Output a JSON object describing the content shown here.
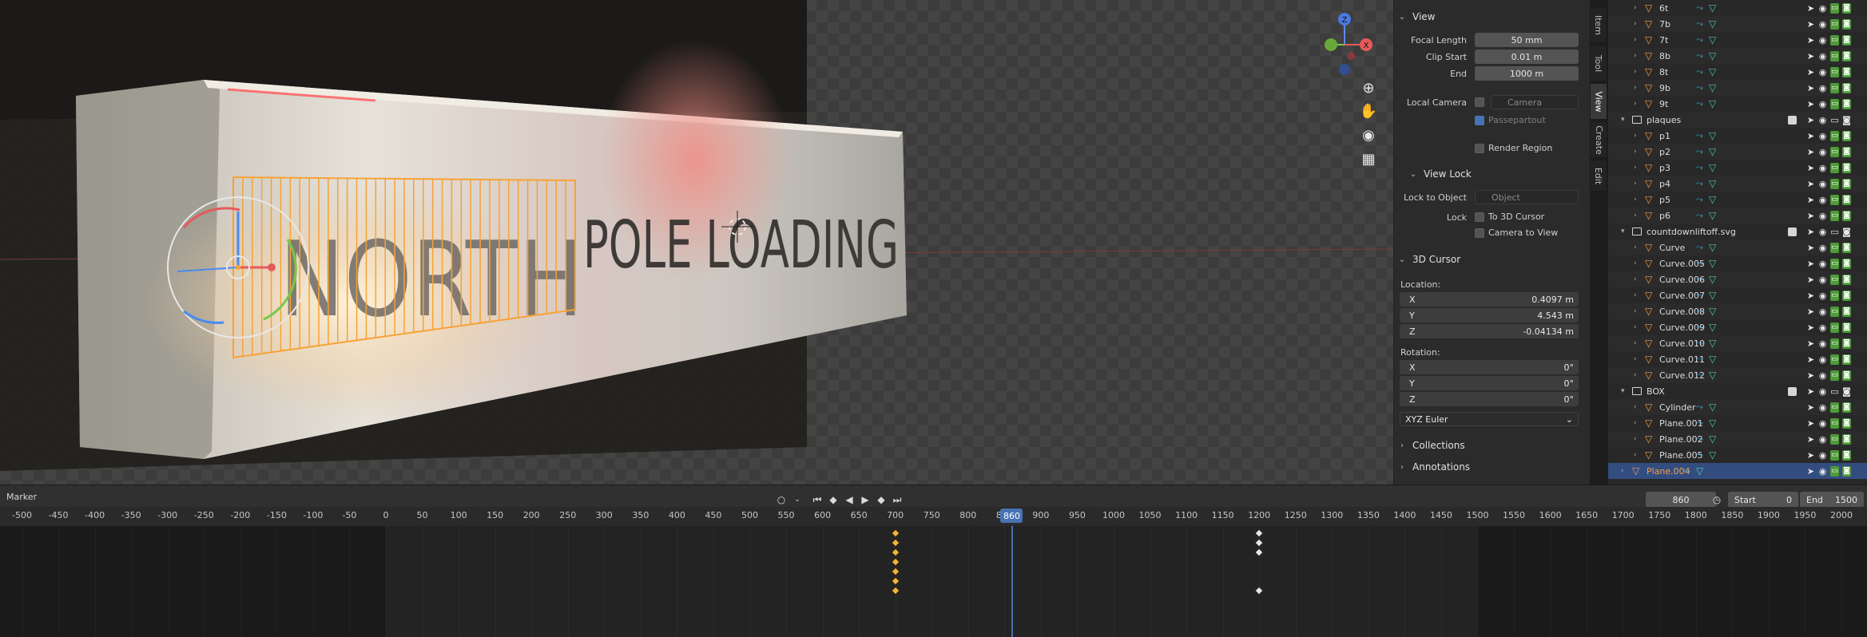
{
  "viewport": {
    "sign_text": "NORTH POLE LOADING",
    "gizmo_axes": {
      "z": "Z",
      "x": "X",
      "y": "Y"
    },
    "tools": [
      "zoom-icon",
      "hand-icon",
      "camera-icon",
      "grid-icon"
    ]
  },
  "tabs": [
    "Item",
    "Tool",
    "View",
    "Create",
    "Edit"
  ],
  "view_panel": {
    "title": "View",
    "focal_length_label": "Focal Length",
    "focal_length": "50 mm",
    "clip_start_label": "Clip Start",
    "clip_start": "0.01 m",
    "end_label": "End",
    "end": "1000 m",
    "local_camera_label": "Local Camera",
    "camera_placeholder": "Camera",
    "passepartout_label": "Passepartout",
    "render_region_label": "Render Region"
  },
  "view_lock": {
    "title": "View Lock",
    "lock_to_object_label": "Lock to Object",
    "object_placeholder": "Object",
    "lock_label": "Lock",
    "to_3d_cursor_label": "To 3D Cursor",
    "camera_to_view_label": "Camera to View"
  },
  "cursor_panel": {
    "title": "3D Cursor",
    "location_label": "Location:",
    "loc": [
      {
        "axis": "X",
        "value": "0.4097 m"
      },
      {
        "axis": "Y",
        "value": "4.543 m"
      },
      {
        "axis": "Z",
        "value": "-0.04134 m"
      }
    ],
    "rotation_label": "Rotation:",
    "rot": [
      {
        "axis": "X",
        "value": "0°"
      },
      {
        "axis": "Y",
        "value": "0°"
      },
      {
        "axis": "Z",
        "value": "0°"
      }
    ],
    "rotation_mode": "XYZ Euler"
  },
  "collections_label": "Collections",
  "annotations_label": "Annotations",
  "outliner": {
    "rows": [
      {
        "name": "6t",
        "depth": 2,
        "kind": "mesh"
      },
      {
        "name": "7b",
        "depth": 2,
        "kind": "mesh"
      },
      {
        "name": "7t",
        "depth": 2,
        "kind": "mesh"
      },
      {
        "name": "8b",
        "depth": 2,
        "kind": "mesh"
      },
      {
        "name": "8t",
        "depth": 2,
        "kind": "mesh"
      },
      {
        "name": "9b",
        "depth": 2,
        "kind": "mesh"
      },
      {
        "name": "9t",
        "depth": 2,
        "kind": "mesh"
      },
      {
        "name": "plaques",
        "depth": 1,
        "kind": "collection"
      },
      {
        "name": "p1",
        "depth": 2,
        "kind": "mesh"
      },
      {
        "name": "p2",
        "depth": 2,
        "kind": "mesh"
      },
      {
        "name": "p3",
        "depth": 2,
        "kind": "mesh"
      },
      {
        "name": "p4",
        "depth": 2,
        "kind": "mesh"
      },
      {
        "name": "p5",
        "depth": 2,
        "kind": "mesh"
      },
      {
        "name": "p6",
        "depth": 2,
        "kind": "mesh"
      },
      {
        "name": "countdownliftoff.svg",
        "depth": 1,
        "kind": "collection"
      },
      {
        "name": "Curve",
        "depth": 2,
        "kind": "mesh"
      },
      {
        "name": "Curve.005",
        "depth": 2,
        "kind": "mesh"
      },
      {
        "name": "Curve.006",
        "depth": 2,
        "kind": "mesh"
      },
      {
        "name": "Curve.007",
        "depth": 2,
        "kind": "mesh"
      },
      {
        "name": "Curve.008",
        "depth": 2,
        "kind": "mesh"
      },
      {
        "name": "Curve.009",
        "depth": 2,
        "kind": "mesh"
      },
      {
        "name": "Curve.010",
        "depth": 2,
        "kind": "mesh"
      },
      {
        "name": "Curve.011",
        "depth": 2,
        "kind": "mesh"
      },
      {
        "name": "Curve.012",
        "depth": 2,
        "kind": "mesh"
      },
      {
        "name": "BOX",
        "depth": 1,
        "kind": "collection"
      },
      {
        "name": "Cylinder",
        "depth": 2,
        "kind": "mesh"
      },
      {
        "name": "Plane.001",
        "depth": 2,
        "kind": "mesh"
      },
      {
        "name": "Plane.002",
        "depth": 2,
        "kind": "mesh"
      },
      {
        "name": "Plane.005",
        "depth": 2,
        "kind": "mesh"
      },
      {
        "name": "Plane.004",
        "depth": 1,
        "kind": "selected"
      }
    ]
  },
  "timeline": {
    "marker_label": "Marker",
    "current_frame": "860",
    "start_label": "Start",
    "start": "0",
    "end_label": "End",
    "end": "1500",
    "ticks": [
      "-500",
      "-450",
      "-400",
      "-350",
      "-300",
      "-250",
      "-200",
      "-150",
      "-100",
      "-50",
      "0",
      "50",
      "100",
      "150",
      "200",
      "250",
      "300",
      "350",
      "400",
      "450",
      "500",
      "550",
      "600",
      "650",
      "700",
      "750",
      "800",
      "850",
      "900",
      "950",
      "1000",
      "1050",
      "1100",
      "1150",
      "1200",
      "1250",
      "1300",
      "1350",
      "1400",
      "1450",
      "1500",
      "1550",
      "1600",
      "1650",
      "1700",
      "1750",
      "1800",
      "1850",
      "1900",
      "1950",
      "2000"
    ],
    "playhead": "860",
    "keys_700": 7,
    "keys_1200": 4
  }
}
